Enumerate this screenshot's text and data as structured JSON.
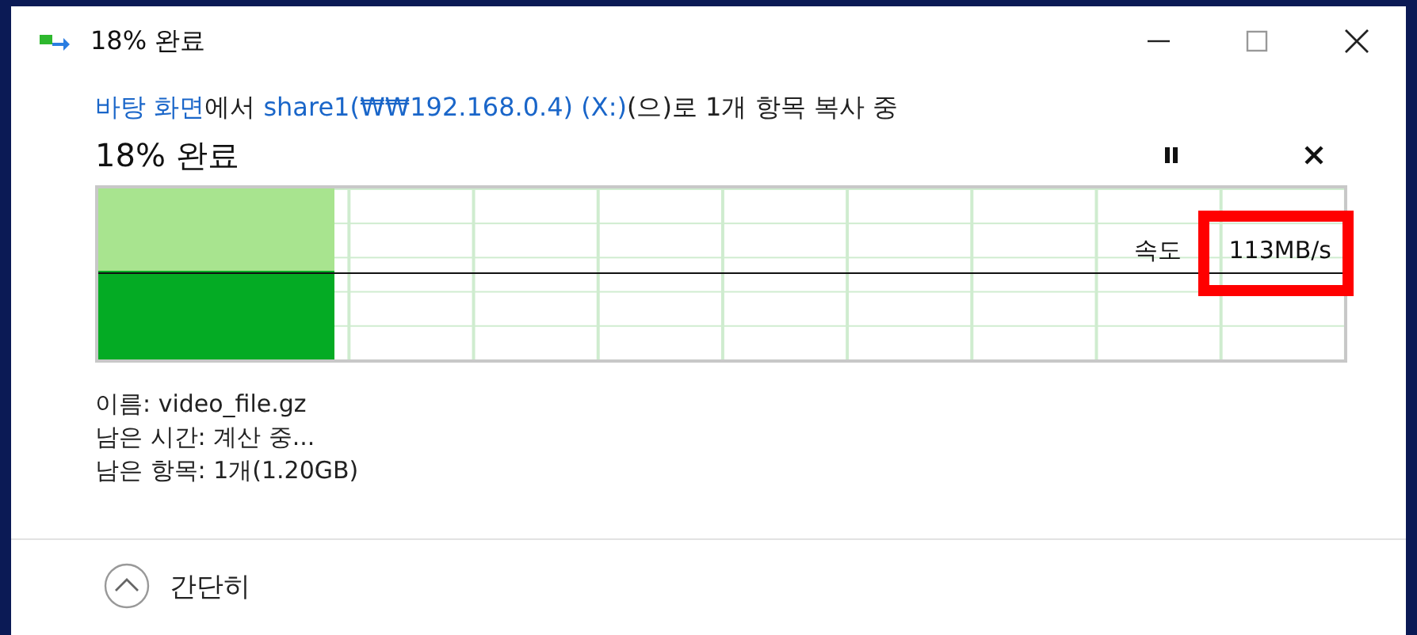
{
  "window": {
    "title": "18% 완료"
  },
  "description": [
    {
      "text": "바탕 화면",
      "kind": "link"
    },
    {
      "text": "에서 ",
      "kind": "plain"
    },
    {
      "text": "share1(₩₩192.168.0.4) (X:)",
      "kind": "link"
    },
    {
      "text": "(으)로 1개 항목 복사 중",
      "kind": "plain"
    }
  ],
  "progress_title": "18% 완료",
  "graph": {
    "level": 0.19,
    "speed_label": "속도",
    "speed_value": "113MB/s"
  },
  "details": [
    "이름: video_file.gz",
    "남은 시간: 계산 중...",
    "남은 항목: 1개(1.20GB)"
  ],
  "toggle": {
    "label": "간단히"
  }
}
